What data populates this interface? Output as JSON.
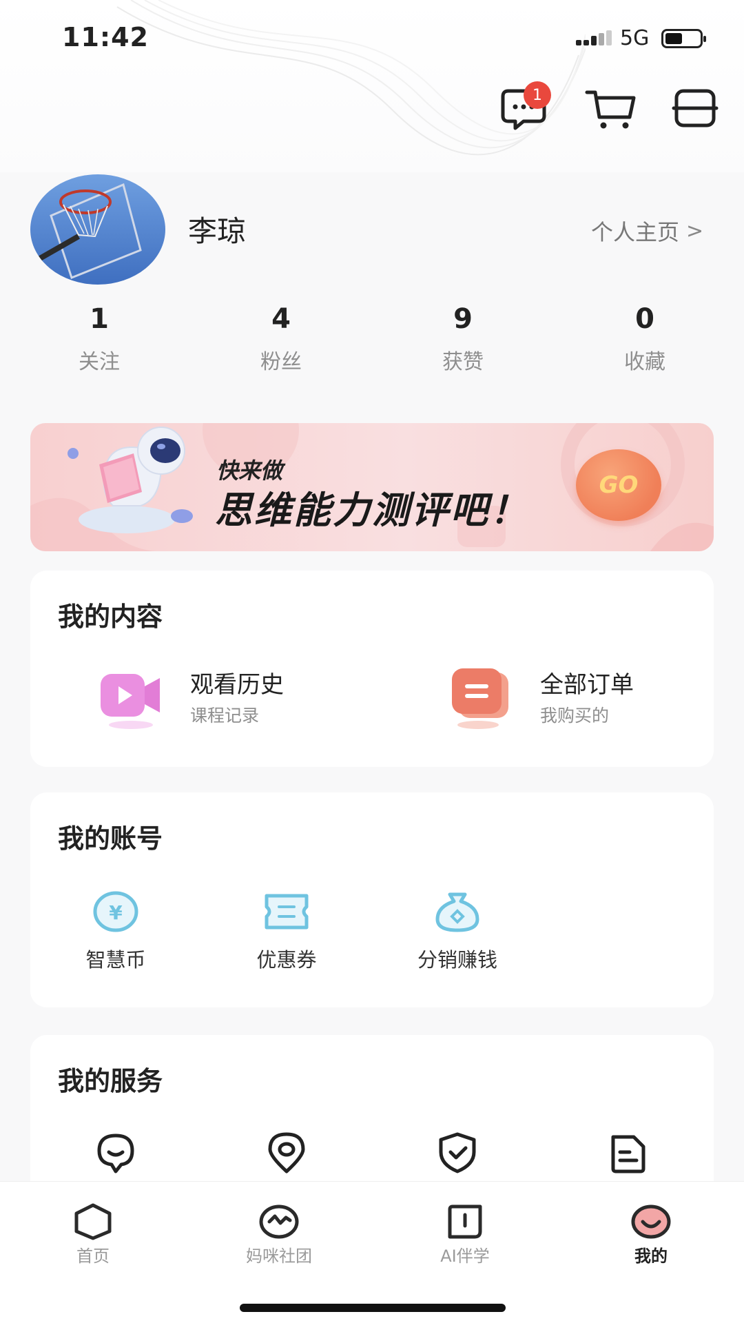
{
  "status_bar": {
    "time": "11:42",
    "network": "5G",
    "battery_percent": 40
  },
  "header": {
    "message_badge": "1",
    "icons": [
      "message-icon",
      "cart-icon",
      "menu-icon"
    ]
  },
  "profile": {
    "username": "李琼",
    "homepage_link": "个人主页",
    "chevron": ">"
  },
  "stats": [
    {
      "value": "1",
      "label": "关注"
    },
    {
      "value": "4",
      "label": "粉丝"
    },
    {
      "value": "9",
      "label": "获赞"
    },
    {
      "value": "0",
      "label": "收藏"
    }
  ],
  "banner": {
    "small_text": "快来做",
    "big_text": "思维能力测评吧！",
    "go_label": "GO"
  },
  "my_content": {
    "title": "我的内容",
    "items": [
      {
        "label": "观看历史",
        "sub": "课程记录",
        "icon": "video-icon"
      },
      {
        "label": "全部订单",
        "sub": "我购买的",
        "icon": "order-icon"
      }
    ]
  },
  "my_account": {
    "title": "我的账号",
    "items": [
      {
        "label": "智慧币",
        "icon": "coin-icon"
      },
      {
        "label": "优惠券",
        "icon": "coupon-icon"
      },
      {
        "label": "分销赚钱",
        "icon": "money-bag-icon"
      }
    ]
  },
  "my_service": {
    "title": "我的服务",
    "icons": [
      "chat-service-icon",
      "location-icon",
      "shield-icon",
      "document-icon"
    ]
  },
  "tabbar": [
    {
      "label": "首页",
      "icon": "home-icon",
      "active": false
    },
    {
      "label": "妈咪社团",
      "icon": "community-icon",
      "active": false
    },
    {
      "label": "AI伴学",
      "icon": "ai-study-icon",
      "active": false
    },
    {
      "label": "我的",
      "icon": "mine-icon",
      "active": true
    }
  ],
  "colors": {
    "accent": "#f07f58",
    "badge": "#e9483d",
    "account_icon": "#6fc3e0",
    "banner_bg": "#f8d0d0"
  }
}
